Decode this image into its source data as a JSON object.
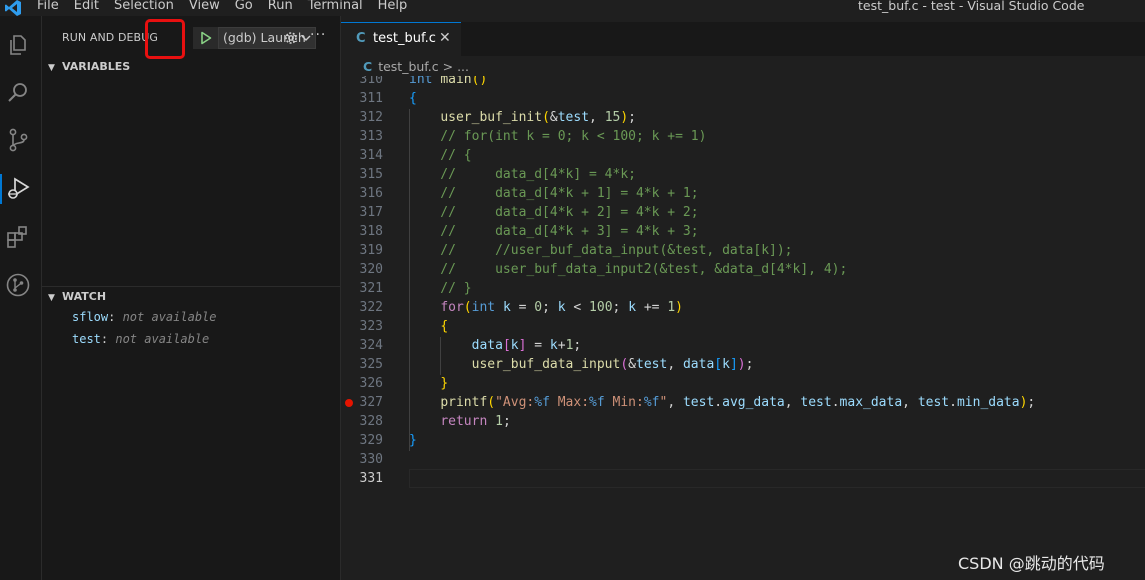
{
  "menu": [
    "File",
    "Edit",
    "Selection",
    "View",
    "Go",
    "Run",
    "Terminal",
    "Help"
  ],
  "window_title": "test_buf.c - test - Visual Studio Code",
  "sidebar": {
    "header": "RUN AND DEBUG",
    "launch_config": "(gdb) Launch",
    "variables_title": "VARIABLES",
    "watch_title": "WATCH",
    "watch": [
      {
        "name": "sflow",
        "value": "not available"
      },
      {
        "name": "test",
        "value": "not available"
      }
    ]
  },
  "editor": {
    "tab_icon": "C",
    "tab_label": "test_buf.c",
    "breadcrumb_file": "test_buf.c",
    "breadcrumb_sep": "> ...",
    "active_line": "331",
    "breakpoint_line": "327",
    "lines": [
      {
        "n": "310",
        "text": "int main()"
      },
      {
        "n": "311",
        "text": "{"
      },
      {
        "n": "312",
        "text": "    user_buf_init(&test, 15);"
      },
      {
        "n": "313",
        "text": "    // for(int k = 0; k < 100; k += 1)"
      },
      {
        "n": "314",
        "text": "    // {"
      },
      {
        "n": "315",
        "text": "    //     data_d[4*k] = 4*k;"
      },
      {
        "n": "316",
        "text": "    //     data_d[4*k + 1] = 4*k + 1;"
      },
      {
        "n": "317",
        "text": "    //     data_d[4*k + 2] = 4*k + 2;"
      },
      {
        "n": "318",
        "text": "    //     data_d[4*k + 3] = 4*k + 3;"
      },
      {
        "n": "319",
        "text": "    //     //user_buf_data_input(&test, data[k]);"
      },
      {
        "n": "320",
        "text": "    //     user_buf_data_input2(&test, &data_d[4*k], 4);"
      },
      {
        "n": "321",
        "text": "    // }"
      },
      {
        "n": "322",
        "text": "    for(int k = 0; k < 100; k += 1)"
      },
      {
        "n": "323",
        "text": "    {"
      },
      {
        "n": "324",
        "text": "        data[k] = k+1;"
      },
      {
        "n": "325",
        "text": "        user_buf_data_input(&test, data[k]);"
      },
      {
        "n": "326",
        "text": "    }"
      },
      {
        "n": "327",
        "text": "    printf(\"Avg:%f Max:%f Min:%f\", test.avg_data, test.max_data, test.min_data);"
      },
      {
        "n": "328",
        "text": "    return 1;"
      },
      {
        "n": "329",
        "text": "}"
      },
      {
        "n": "330",
        "text": ""
      },
      {
        "n": "331",
        "text": ""
      }
    ]
  },
  "watermark": "CSDN @跳动的代码",
  "colors": {
    "accent": "#0078d4",
    "breakpoint": "#e51400",
    "highlight_box": "#e81010",
    "run_icon": "#89d185"
  }
}
